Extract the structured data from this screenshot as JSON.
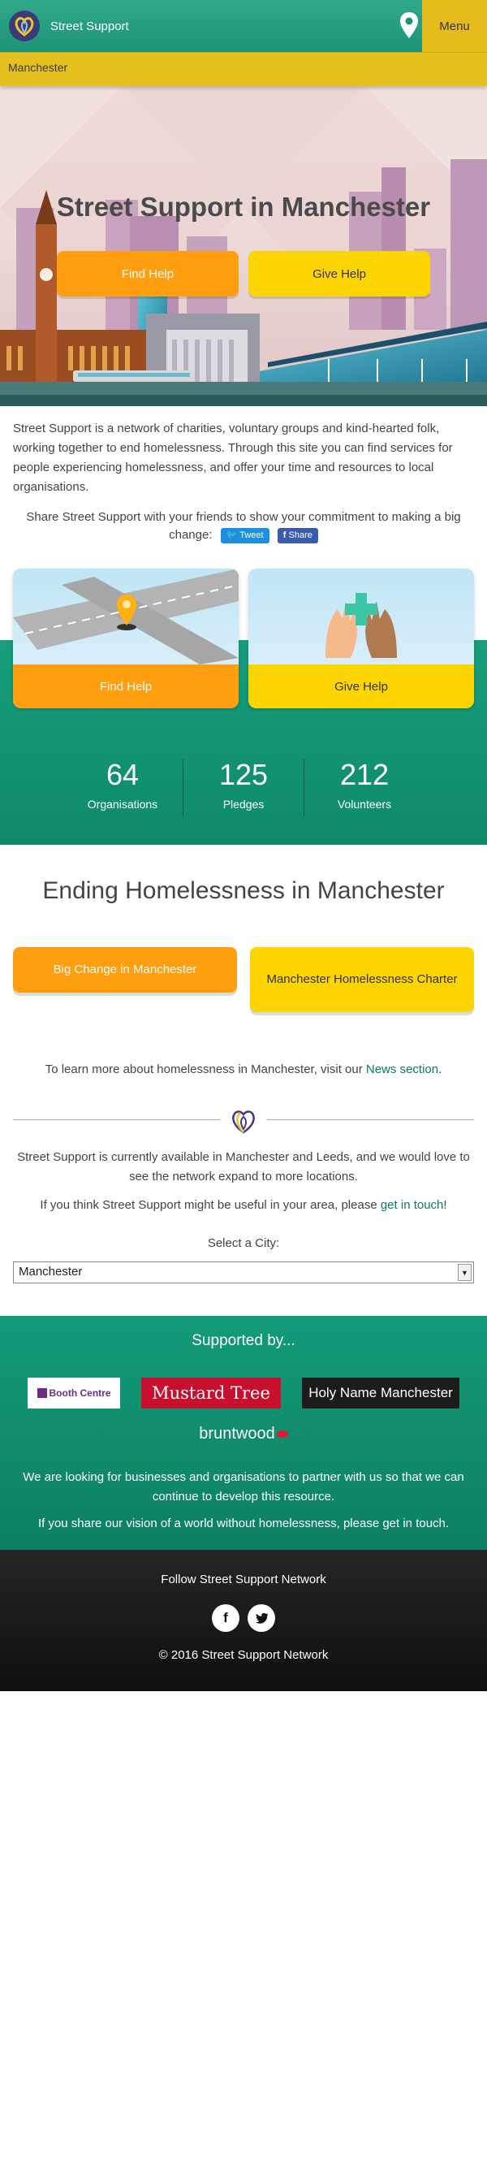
{
  "header": {
    "brand": "Street Support",
    "menu_label": "Menu",
    "city_bar": "Manchester"
  },
  "hero": {
    "title": "Street Support in Manchester",
    "find_help": "Find Help",
    "give_help": "Give Help"
  },
  "intro": {
    "text": "Street Support is a network of charities, voluntary groups and kind-hearted folk, working together to end homelessness. Through this site you can find services for people experiencing homelessness, and offer your time and resources to local organisations.",
    "share_text": "Share Street Support with your friends to show your commitment to making a big change:",
    "tweet_label": "Tweet",
    "fb_label": "Share"
  },
  "cards": {
    "find_help": "Find Help",
    "give_help": "Give Help"
  },
  "stats": [
    {
      "value": "64",
      "label": "Organisations"
    },
    {
      "value": "125",
      "label": "Pledges"
    },
    {
      "value": "212",
      "label": "Volunteers"
    }
  ],
  "ending": {
    "title": "Ending Homelessness in Manchester",
    "btn_big_change": "Big Change in Manchester",
    "btn_charter": "Manchester Homelessness Charter",
    "learn_prefix": "To learn more about homelessness in Manchester, visit our ",
    "learn_link": "News section",
    "learn_suffix": "."
  },
  "availability": {
    "text": "Street Support is currently available in Manchester and Leeds, and we would love to see the network expand to more locations.",
    "getin_prefix": "If you think Street Support might be useful in your area, please ",
    "getin_link": "get in touch",
    "getin_suffix": "!",
    "select_label": "Select a City:",
    "selected_city": "Manchester"
  },
  "supported": {
    "title": "Supported by...",
    "logos": {
      "booth": "Booth Centre",
      "mustard": "Mustard Tree",
      "holy": "Holy Name Manchester",
      "bruntwood": "bruntwood"
    },
    "partner_prefix": "We are looking for businesses and organisations to ",
    "partner_link": "partner with us",
    "partner_suffix": " so that we can continue to develop this resource.",
    "vision_prefix": "If you share our vision of a world without homelessness, please ",
    "vision_link": "get in touch",
    "vision_suffix": "."
  },
  "footer": {
    "follow": "Follow Street Support Network",
    "facebook_glyph": "f",
    "copyright": "© 2016 Street Support Network"
  },
  "colors": {
    "green": "#1e9477",
    "yellow": "#fcd400",
    "orange": "#ff9e0f",
    "gold_bar": "#e4c11e"
  }
}
